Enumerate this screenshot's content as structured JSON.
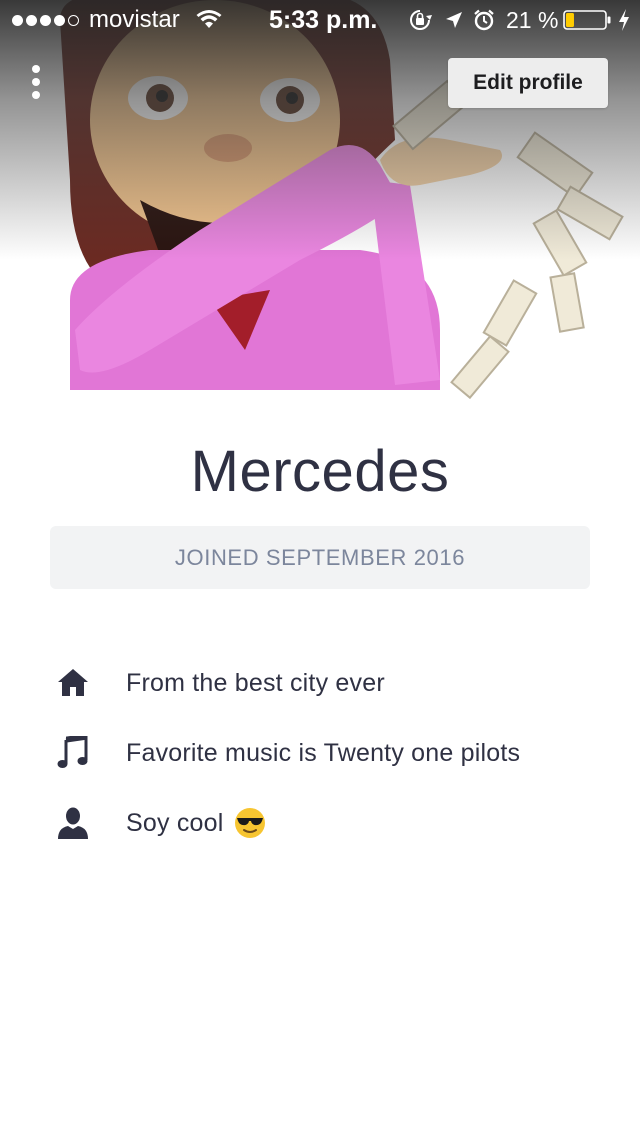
{
  "status_bar": {
    "signal_bars_filled": 4,
    "signal_bars_total": 5,
    "carrier": "movistar",
    "time": "5:33 p.m.",
    "battery_percent": "21 %",
    "battery_level": 0.21,
    "battery_color": "#ffcc00",
    "icons": [
      "wifi-icon",
      "rotation-lock-icon",
      "location-icon",
      "alarm-icon",
      "battery-icon",
      "charging-icon"
    ]
  },
  "header": {
    "more_icon": "more-vertical-icon",
    "edit_profile_label": "Edit profile"
  },
  "profile": {
    "name": "Mercedes",
    "joined": "JOINED SEPTEMBER 2016"
  },
  "details": [
    {
      "icon": "home-icon",
      "text": "From the best city ever"
    },
    {
      "icon": "music-note-icon",
      "text": "Favorite music is Twenty one pilots"
    },
    {
      "icon": "person-icon",
      "text": "Soy cool",
      "emoji": "smiling-face-with-sunglasses"
    }
  ],
  "colors": {
    "text_primary": "#2f3143",
    "text_muted": "#7c869c",
    "joined_bg": "#f2f3f4",
    "button_bg": "#ededed"
  }
}
